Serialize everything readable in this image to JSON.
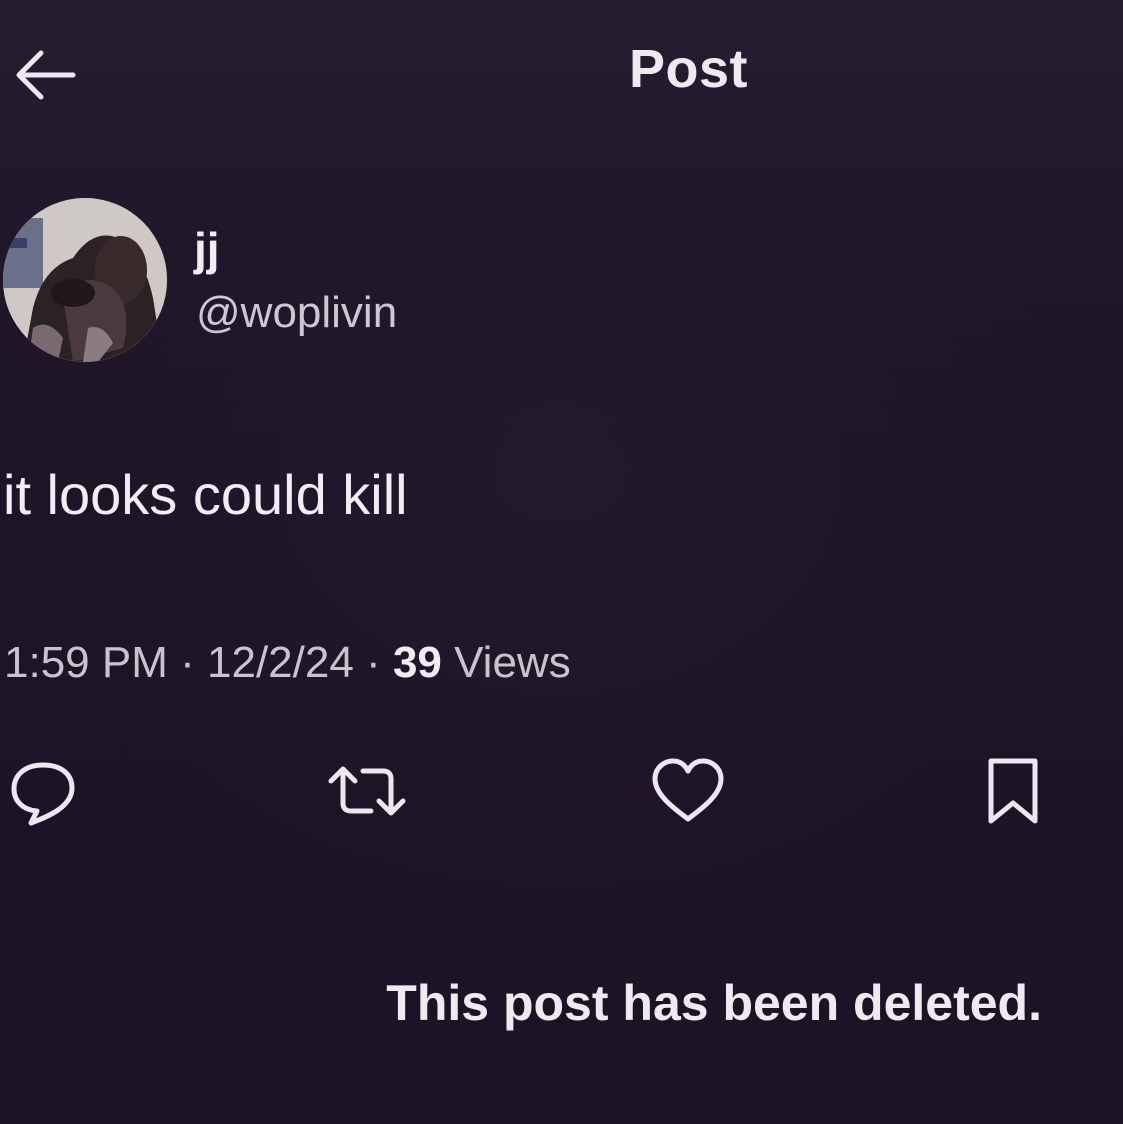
{
  "header": {
    "title": "Post",
    "back_icon": "arrow-left-icon"
  },
  "author": {
    "display_name": "jj",
    "handle": "@woplivin"
  },
  "post": {
    "text": "it looks could kill",
    "time": "1:59 PM",
    "separator": "·",
    "date": "12/2/24",
    "views_count": "39",
    "views_label": "Views"
  },
  "actions": [
    {
      "name": "reply",
      "icon": "speech-bubble-icon"
    },
    {
      "name": "repost",
      "icon": "repost-arrows-icon"
    },
    {
      "name": "like",
      "icon": "heart-icon"
    },
    {
      "name": "bookmark",
      "icon": "bookmark-icon"
    }
  ],
  "notice": {
    "text": "This post has been deleted."
  },
  "colors": {
    "background": "#1c1425",
    "text": "#f1edf2",
    "secondary_text": "#c9c3ce"
  }
}
